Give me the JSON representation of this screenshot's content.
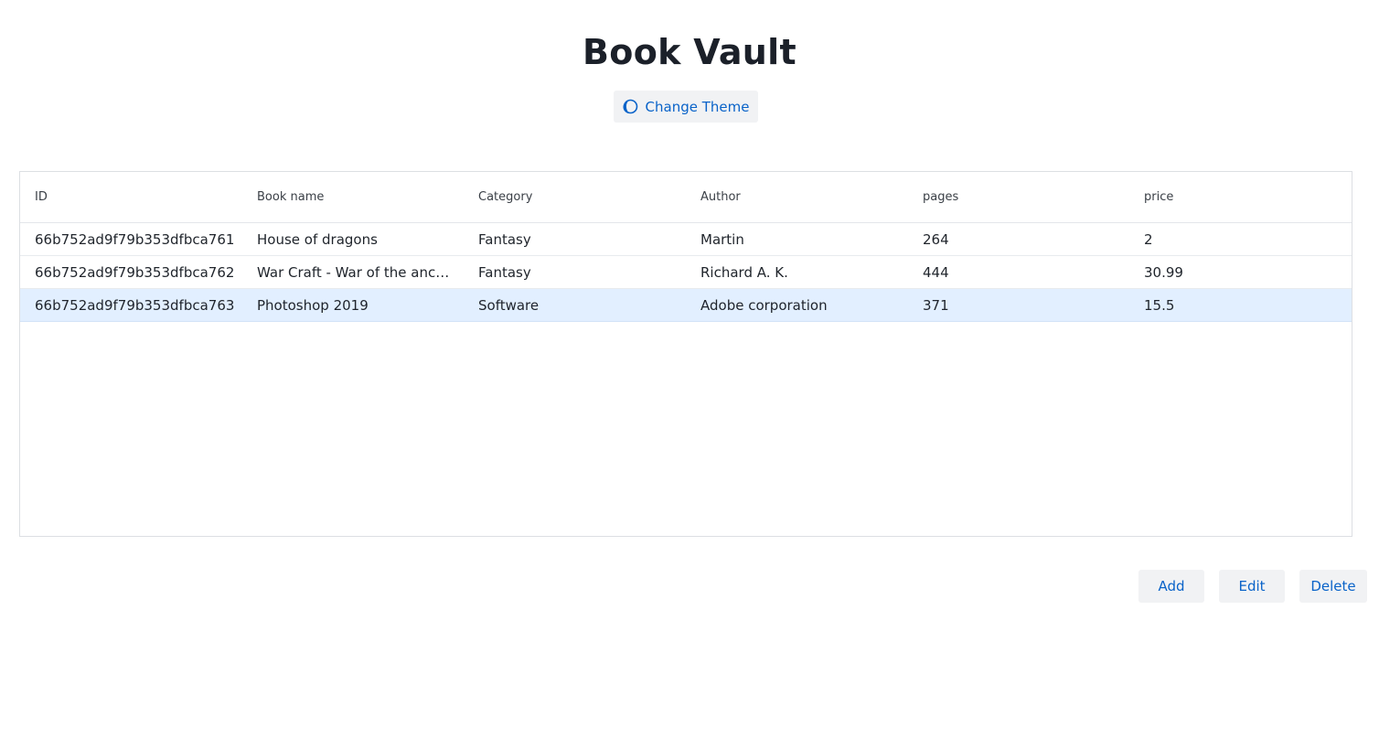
{
  "app": {
    "title": "Book Vault"
  },
  "theme_button": {
    "label": "Change Theme",
    "icon": "theme-half-circle-icon"
  },
  "table": {
    "columns": [
      "ID",
      "Book name",
      "Category",
      "Author",
      "pages",
      "price"
    ],
    "rows": [
      [
        "66b752ad9f79b353dfbca761",
        "House of dragons",
        "Fantasy",
        "Martin",
        "264",
        "2"
      ],
      [
        "66b752ad9f79b353dfbca762",
        "War Craft - War of the ancients",
        "Fantasy",
        "Richard A. K.",
        "444",
        "30.99"
      ],
      [
        "66b752ad9f79b353dfbca763",
        "Photoshop 2019",
        "Software",
        "Adobe corporation",
        "371",
        "15.5"
      ]
    ],
    "selected_row": 2
  },
  "actions": {
    "add_label": "Add",
    "edit_label": "Edit",
    "delete_label": "Delete"
  },
  "colors": {
    "accent": "#0a63c9",
    "button_bg": "#f1f2f4",
    "selected_row_bg": "#e2efff",
    "title_text": "#1b2029"
  }
}
